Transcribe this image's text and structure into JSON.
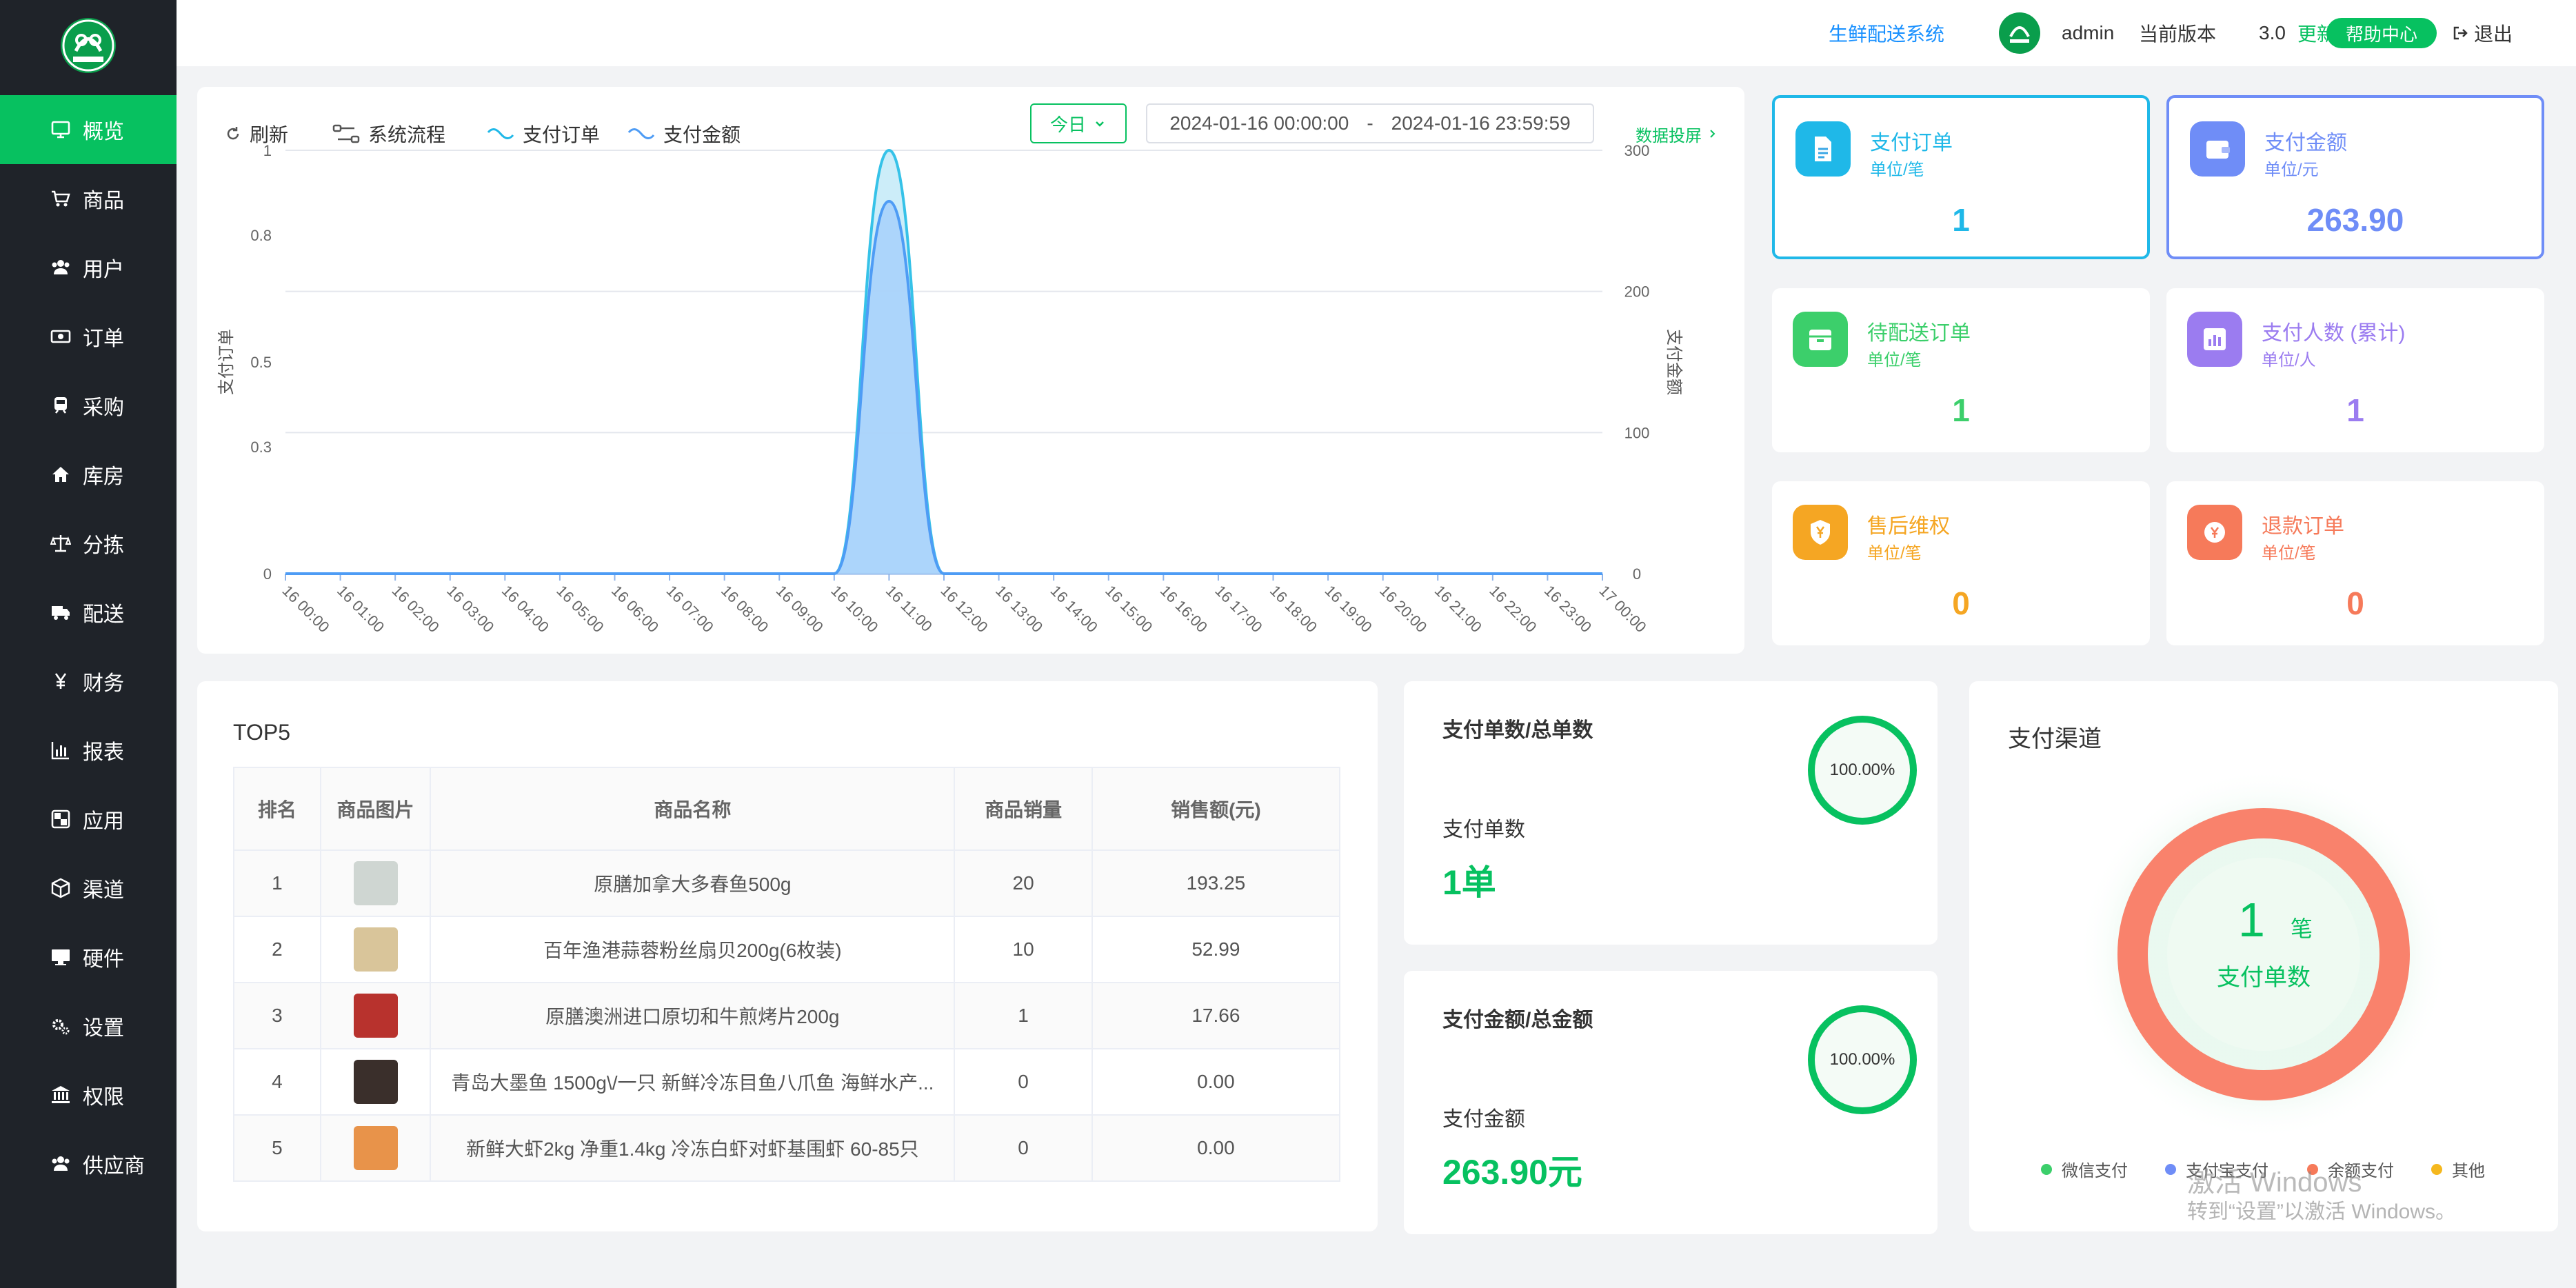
{
  "header": {
    "system_name": "生鲜配送系统",
    "user": "admin",
    "version_label": "当前版本",
    "version": "3.0",
    "update_label": "更新",
    "help_label": "帮助中心",
    "logout_label": "退出"
  },
  "sidebar": {
    "items": [
      {
        "label": "概览",
        "icon": "monitor-icon",
        "active": true
      },
      {
        "label": "商品",
        "icon": "cart-icon"
      },
      {
        "label": "用户",
        "icon": "users-icon"
      },
      {
        "label": "订单",
        "icon": "money-icon"
      },
      {
        "label": "采购",
        "icon": "train-icon"
      },
      {
        "label": "库房",
        "icon": "home-icon"
      },
      {
        "label": "分拣",
        "icon": "balance-icon"
      },
      {
        "label": "配送",
        "icon": "truck-icon"
      },
      {
        "label": "财务",
        "icon": "yen-icon"
      },
      {
        "label": "报表",
        "icon": "bar-chart-icon"
      },
      {
        "label": "应用",
        "icon": "apps-icon"
      },
      {
        "label": "渠道",
        "icon": "cube-icon"
      },
      {
        "label": "硬件",
        "icon": "desktop-icon"
      },
      {
        "label": "设置",
        "icon": "gears-icon"
      },
      {
        "label": "权限",
        "icon": "bank-icon"
      },
      {
        "label": "供应商",
        "icon": "supplier-icon"
      }
    ]
  },
  "toolbar": {
    "refresh": "刷新",
    "flow": "系统流程",
    "series_orders": "支付订单",
    "series_amount": "支付金额",
    "today": "今日",
    "range_start": "2024-01-16 00:00:00",
    "range_sep": "-",
    "range_end": "2024-01-16 23:59:59",
    "screen": "数据投屏"
  },
  "chart_data": {
    "type": "area",
    "x": [
      "16 00:00",
      "16 01:00",
      "16 02:00",
      "16 03:00",
      "16 04:00",
      "16 05:00",
      "16 06:00",
      "16 07:00",
      "16 08:00",
      "16 09:00",
      "16 10:00",
      "16 11:00",
      "16 12:00",
      "16 13:00",
      "16 14:00",
      "16 15:00",
      "16 16:00",
      "16 17:00",
      "16 18:00",
      "16 19:00",
      "16 20:00",
      "16 21:00",
      "16 22:00",
      "16 23:00",
      "17 00:00"
    ],
    "series": [
      {
        "name": "支付订单",
        "axis": "left",
        "color": "#36c2e8",
        "values": [
          0,
          0,
          0,
          0,
          0,
          0,
          0,
          0,
          0,
          0,
          0,
          1,
          0,
          0,
          0,
          0,
          0,
          0,
          0,
          0,
          0,
          0,
          0,
          0,
          0
        ]
      },
      {
        "name": "支付金额",
        "axis": "right",
        "color": "#4e9cf5",
        "values": [
          0,
          0,
          0,
          0,
          0,
          0,
          0,
          0,
          0,
          0,
          0,
          263.9,
          0,
          0,
          0,
          0,
          0,
          0,
          0,
          0,
          0,
          0,
          0,
          0,
          0
        ]
      }
    ],
    "ylabel_left": "支付订单",
    "ylabel_right": "支付金额",
    "yticks_left": [
      "0",
      "0.3",
      "0.5",
      "0.8",
      "1"
    ],
    "yticks_right": [
      "0",
      "100",
      "200",
      "300"
    ],
    "ylim_left": [
      0,
      1
    ],
    "ylim_right": [
      0,
      300
    ],
    "grid": true
  },
  "stats": [
    {
      "title": "支付订单",
      "unit": "单位/笔",
      "value": "1",
      "color": "#1fb8e8",
      "icon": "document-icon"
    },
    {
      "title": "支付金额",
      "unit": "单位/元",
      "value": "263.90",
      "color": "#6f8df7",
      "icon": "wallet-icon"
    },
    {
      "title": "待配送订单",
      "unit": "单位/笔",
      "value": "1",
      "color": "#3ccf6b",
      "icon": "box-icon"
    },
    {
      "title": "支付人数 (累计)",
      "unit": "单位/人",
      "value": "1",
      "color": "#9b7cf0",
      "icon": "stats-icon"
    },
    {
      "title": "售后维权",
      "unit": "单位/笔",
      "value": "0",
      "color": "#f5a623",
      "icon": "shield-yen-icon"
    },
    {
      "title": "退款订单",
      "unit": "单位/笔",
      "value": "0",
      "color": "#f67a5a",
      "icon": "refund-icon"
    }
  ],
  "top5": {
    "title": "TOP5",
    "headers": [
      "排名",
      "商品图片",
      "商品名称",
      "商品销量",
      "销售额(元)"
    ],
    "rows": [
      {
        "rank": "1",
        "name": "原膳加拿大多春鱼500g",
        "qty": "20",
        "amount": "193.25",
        "thumb": "#cfd6d2"
      },
      {
        "rank": "2",
        "name": "百年渔港蒜蓉粉丝扇贝200g(6枚装)",
        "qty": "10",
        "amount": "52.99",
        "thumb": "#d9c59a"
      },
      {
        "rank": "3",
        "name": "原膳澳洲进口原切和牛煎烤片200g",
        "qty": "1",
        "amount": "17.66",
        "thumb": "#b8322d"
      },
      {
        "rank": "4",
        "name": "青岛大墨鱼 1500g\\/一只 新鲜冷冻目鱼八爪鱼 海鲜水产...",
        "qty": "0",
        "amount": "0.00",
        "thumb": "#3a2f2b"
      },
      {
        "rank": "5",
        "name": "新鲜大虾2kg 净重1.4kg 冷冻白虾对虾基围虾 60-85只",
        "qty": "0",
        "amount": "0.00",
        "thumb": "#e8934a"
      }
    ]
  },
  "ratio_orders": {
    "title": "支付单数/总单数",
    "pct": "100.00%",
    "pct_value": 1.0,
    "label": "支付单数",
    "value": "1单"
  },
  "ratio_amount": {
    "title": "支付金额/总金额",
    "pct": "100.00%",
    "pct_value": 1.0,
    "label": "支付金额",
    "value": "263.90元"
  },
  "channel": {
    "title": "支付渠道",
    "count": "1",
    "unit": "笔",
    "label": "支付单数",
    "legend": [
      {
        "name": "微信支付",
        "color": "#3ccf6b"
      },
      {
        "name": "支付宝支付",
        "color": "#6f8df7"
      },
      {
        "name": "余额支付",
        "color": "#f67a5a"
      },
      {
        "name": "其他",
        "color": "#f5b81e"
      }
    ]
  },
  "watermark": {
    "line1": "激活 Windows",
    "line2": "转到“设置”以激活 Windows。"
  }
}
